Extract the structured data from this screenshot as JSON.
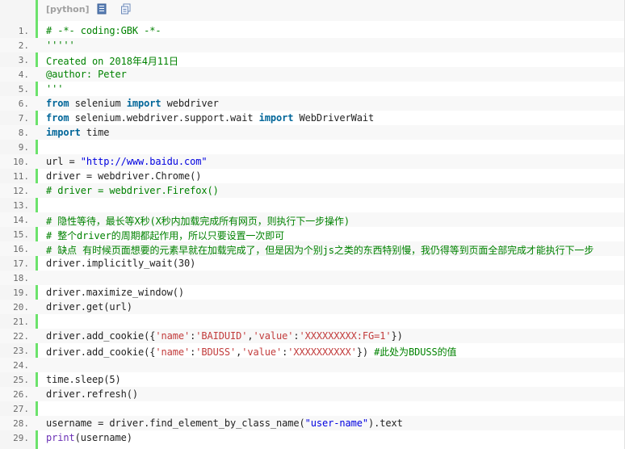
{
  "toolbar": {
    "language_label": "[python]",
    "view_icon": "view-source-icon",
    "copy_icon": "copy-icon"
  },
  "lines": [
    {
      "n": "1.",
      "t": [
        {
          "c": "cm",
          "v": "# -*- coding:GBK -*-"
        }
      ]
    },
    {
      "n": "2.",
      "t": [
        {
          "c": "cm",
          "v": "'''''"
        }
      ]
    },
    {
      "n": "3.",
      "t": [
        {
          "c": "cm",
          "v": "Created on 2018年4月11日"
        }
      ]
    },
    {
      "n": "4.",
      "t": [
        {
          "c": "cm",
          "v": "@author: Peter"
        }
      ]
    },
    {
      "n": "5.",
      "t": [
        {
          "c": "cm",
          "v": "'''"
        }
      ]
    },
    {
      "n": "6.",
      "t": [
        {
          "c": "kw",
          "v": "from"
        },
        {
          "c": "",
          "v": " selenium "
        },
        {
          "c": "kw",
          "v": "import"
        },
        {
          "c": "",
          "v": " webdriver"
        }
      ]
    },
    {
      "n": "7.",
      "t": [
        {
          "c": "kw",
          "v": "from"
        },
        {
          "c": "",
          "v": " selenium.webdriver.support.wait "
        },
        {
          "c": "kw",
          "v": "import"
        },
        {
          "c": "",
          "v": " WebDriverWait"
        }
      ]
    },
    {
      "n": "8.",
      "t": [
        {
          "c": "kw",
          "v": "import"
        },
        {
          "c": "",
          "v": " time"
        }
      ]
    },
    {
      "n": "9.",
      "t": []
    },
    {
      "n": "10.",
      "t": [
        {
          "c": "",
          "v": "url = "
        },
        {
          "c": "str",
          "v": "\"http://www.baidu.com\""
        }
      ]
    },
    {
      "n": "11.",
      "t": [
        {
          "c": "",
          "v": "driver = webdriver.Chrome()"
        }
      ]
    },
    {
      "n": "12.",
      "t": [
        {
          "c": "cm",
          "v": "# driver = webdriver.Firefox()"
        }
      ]
    },
    {
      "n": "13.",
      "t": []
    },
    {
      "n": "14.",
      "t": [
        {
          "c": "cm",
          "v": "# 隐性等待，最长等X秒(X秒内加载完成所有网页，则执行下一步操作)"
        }
      ]
    },
    {
      "n": "15.",
      "t": [
        {
          "c": "cm",
          "v": "# 整个driver的周期都起作用，所以只要设置一次即可"
        }
      ]
    },
    {
      "n": "16.",
      "t": [
        {
          "c": "cm",
          "v": "# 缺点 有时候页面想要的元素早就在加载完成了，但是因为个别js之类的东西特别慢，我仍得等到页面全部完成才能执行下一步"
        }
      ]
    },
    {
      "n": "17.",
      "t": [
        {
          "c": "",
          "v": "driver.implicitly_wait(30)"
        }
      ]
    },
    {
      "n": "18.",
      "t": []
    },
    {
      "n": "19.",
      "t": [
        {
          "c": "",
          "v": "driver.maximize_window()"
        }
      ]
    },
    {
      "n": "20.",
      "t": [
        {
          "c": "",
          "v": "driver.get(url)"
        }
      ]
    },
    {
      "n": "21.",
      "t": []
    },
    {
      "n": "22.",
      "t": [
        {
          "c": "",
          "v": "driver.add_cookie({"
        },
        {
          "c": "st",
          "v": "'name'"
        },
        {
          "c": "",
          "v": ":"
        },
        {
          "c": "st",
          "v": "'BAIDUID'"
        },
        {
          "c": "",
          "v": ","
        },
        {
          "c": "st",
          "v": "'value'"
        },
        {
          "c": "",
          "v": ":"
        },
        {
          "c": "st",
          "v": "'XXXXXXXXX:FG=1'"
        },
        {
          "c": "",
          "v": "})"
        }
      ]
    },
    {
      "n": "23.",
      "t": [
        {
          "c": "",
          "v": "driver.add_cookie({"
        },
        {
          "c": "st",
          "v": "'name'"
        },
        {
          "c": "",
          "v": ":"
        },
        {
          "c": "st",
          "v": "'BDUSS'"
        },
        {
          "c": "",
          "v": ","
        },
        {
          "c": "st",
          "v": "'value'"
        },
        {
          "c": "",
          "v": ":"
        },
        {
          "c": "st",
          "v": "'XXXXXXXXXX'"
        },
        {
          "c": "",
          "v": "}) "
        },
        {
          "c": "cm",
          "v": "#此处为BDUSS的值"
        }
      ]
    },
    {
      "n": "24.",
      "t": []
    },
    {
      "n": "25.",
      "t": [
        {
          "c": "",
          "v": "time.sleep(5)"
        }
      ]
    },
    {
      "n": "26.",
      "t": [
        {
          "c": "",
          "v": "driver.refresh()"
        }
      ]
    },
    {
      "n": "27.",
      "t": []
    },
    {
      "n": "28.",
      "t": [
        {
          "c": "",
          "v": "username = driver.find_element_by_class_name("
        },
        {
          "c": "str",
          "v": "\"user-name\""
        },
        {
          "c": "",
          "v": ").text"
        }
      ]
    },
    {
      "n": "29.",
      "t": [
        {
          "c": "bi",
          "v": "print"
        },
        {
          "c": "",
          "v": "(username)"
        }
      ]
    }
  ]
}
